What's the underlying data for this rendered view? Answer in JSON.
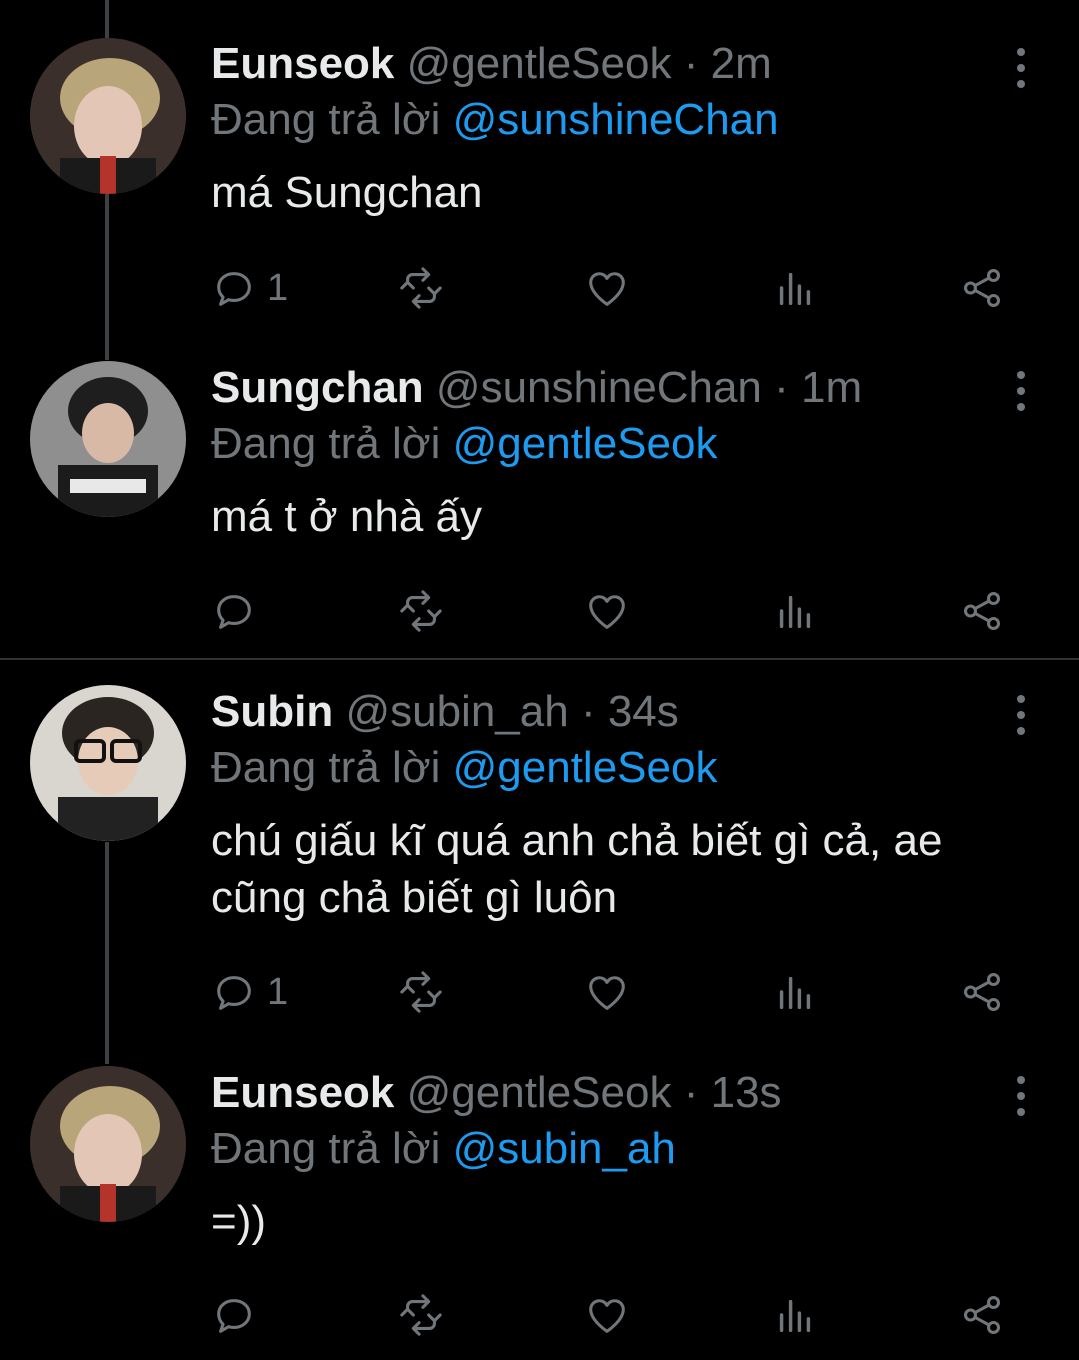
{
  "reply_prefix": "Đang trả lời",
  "tweets": [
    {
      "name": "Eunseok",
      "handle": "@gentleSeok",
      "separator": "·",
      "time": "2m",
      "reply_to": "@sunshineChan",
      "text": "má Sungchan",
      "reply_count": "1"
    },
    {
      "name": "Sungchan",
      "handle": "@sunshineChan",
      "separator": "·",
      "time": "1m",
      "reply_to": "@gentleSeok",
      "text": "má t ở nhà ấy",
      "reply_count": ""
    },
    {
      "name": "Subin",
      "handle": "@subin_ah",
      "separator": "·",
      "time": "34s",
      "reply_to": "@gentleSeok",
      "text": "chú giấu kĩ quá anh chả biết gì cả, ae cũng chả biết gì luôn",
      "reply_count": "1"
    },
    {
      "name": "Eunseok",
      "handle": "@gentleSeok",
      "separator": "·",
      "time": "13s",
      "reply_to": "@subin_ah",
      "text": "=))",
      "reply_count": ""
    }
  ],
  "icons": {
    "reply": "reply-icon",
    "retweet": "retweet-icon",
    "like": "heart-icon",
    "views": "views-icon",
    "share": "share-icon",
    "more": "more-vertical-icon"
  },
  "colors": {
    "background": "#000000",
    "text": "#e7e9ea",
    "muted": "#71767b",
    "accent": "#1d9bf0"
  }
}
